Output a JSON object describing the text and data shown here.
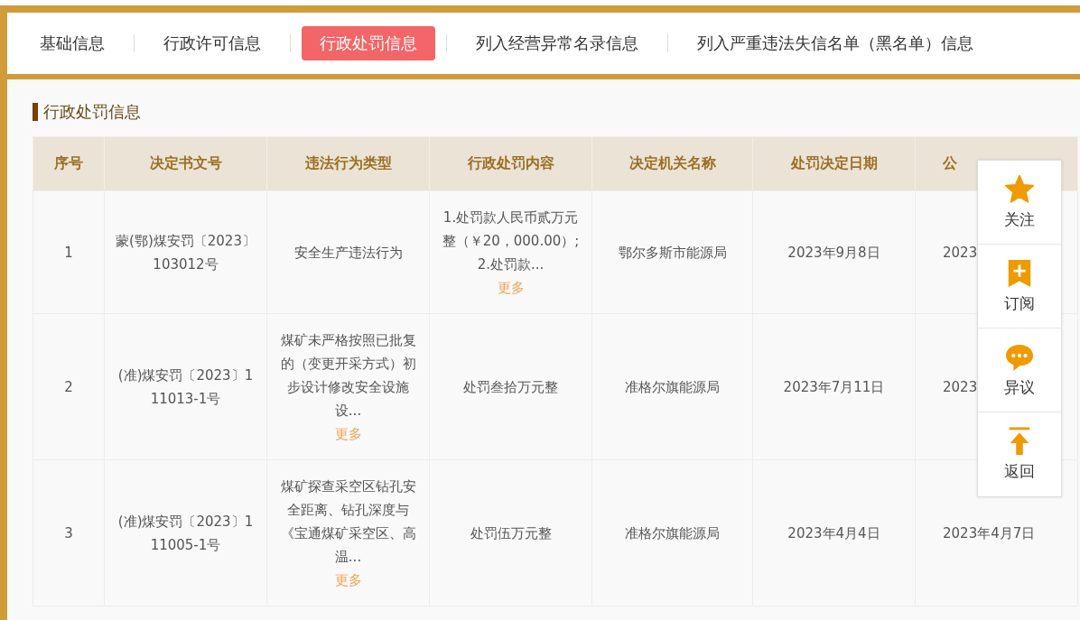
{
  "tabs": [
    {
      "label": "基础信息",
      "selected": false
    },
    {
      "label": "行政许可信息",
      "selected": false
    },
    {
      "label": "行政处罚信息",
      "selected": true
    },
    {
      "label": "列入经营异常名录信息",
      "selected": false
    },
    {
      "label": "列入严重违法失信名单（黑名单）信息",
      "selected": false
    }
  ],
  "section_title": "行政处罚信息",
  "table": {
    "columns": [
      "序号",
      "决定书文号",
      "违法行为类型",
      "行政处罚内容",
      "决定机关名称",
      "处罚决定日期",
      "公"
    ],
    "rows": [
      {
        "seq": "1",
        "doc_no": "蒙(鄂)煤安罚〔2023〕103012号",
        "violation": {
          "text": "安全生产违法行为"
        },
        "penalty": {
          "text": "1.处罚款人民币贰万元整（￥20，000.00）;2.处罚款...",
          "more": "更多"
        },
        "authority": "鄂尔多斯市能源局",
        "decision_date": "2023年9月8日",
        "publish_date": "2023"
      },
      {
        "seq": "2",
        "doc_no": "(准)煤安罚〔2023〕111013-1号",
        "violation": {
          "text": "煤矿未严格按照已批复的（变更开采方式）初步设计修改安全设施设...",
          "more": "更多"
        },
        "penalty": {
          "text": "处罚叁拾万元整"
        },
        "authority": "准格尔旗能源局",
        "decision_date": "2023年7月11日",
        "publish_date": "2023"
      },
      {
        "seq": "3",
        "doc_no": "(准)煤安罚〔2023〕111005-1号",
        "violation": {
          "text": "煤矿探查采空区钻孔安全距离、钻孔深度与《宝通煤矿采空区、高温...",
          "more": "更多"
        },
        "penalty": {
          "text": "处罚伍万元整"
        },
        "authority": "准格尔旗能源局",
        "decision_date": "2023年4月4日",
        "publish_date": "2023年4月7日"
      }
    ]
  },
  "float_menu": [
    {
      "kind": "star",
      "label": "关注"
    },
    {
      "kind": "bookmark",
      "label": "订阅"
    },
    {
      "kind": "chat",
      "label": "异议"
    },
    {
      "kind": "top",
      "label": "返回"
    }
  ]
}
